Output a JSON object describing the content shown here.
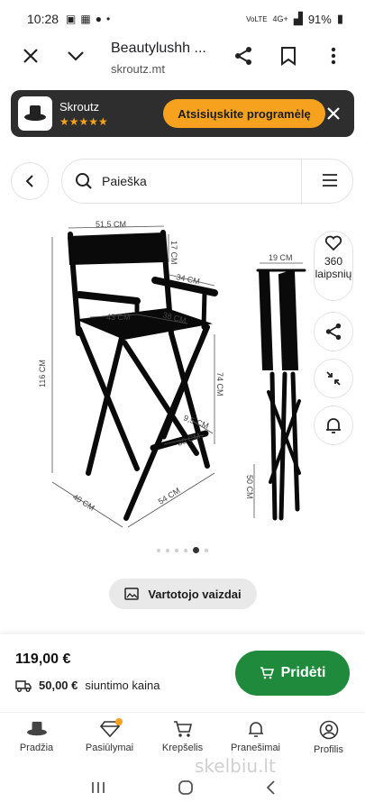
{
  "status": {
    "time": "10:28",
    "battery": "91%",
    "network": "4G+",
    "volte": "VoLTE"
  },
  "browser": {
    "title": "Beautylushh ...",
    "url": "skroutz.mt"
  },
  "banner": {
    "app_name": "Skroutz",
    "rating_stars": "★★★★★",
    "cta_label": "Atsisiųskite programėlę",
    "accent": "#f6a21f"
  },
  "search": {
    "placeholder": "Paieška"
  },
  "product_image": {
    "dimensions": {
      "seat_width": "51,5 CM",
      "back_height": "17 CM",
      "armrest": "34 CM",
      "seat_depth_a": "43 CM",
      "seat_depth_b": "38 CM",
      "total_height": "116 CM",
      "seat_height": "74 CM",
      "footrest": "9,5 CM",
      "footrest_width": "30 CM",
      "base_depth": "40 CM",
      "base_width": "54 CM",
      "folded_width": "19 CM",
      "folded_depth": "50 CM"
    }
  },
  "favorites": {
    "count": "360",
    "label": "laipsnių"
  },
  "gallery": {
    "total": 6,
    "active_index": 4
  },
  "user_images_label": "Vartotojo vaizdai",
  "purchase": {
    "price": "119,00 €",
    "shipping_amount": "50,00 €",
    "shipping_label": "siuntimo kaina",
    "add_label": "Pridėti",
    "accent": "#1f8a3c"
  },
  "tabs": [
    {
      "label": "Pradžia",
      "icon": "home-hat-icon"
    },
    {
      "label": "Pasiūlymai",
      "icon": "diamond-icon"
    },
    {
      "label": "Krepšelis",
      "icon": "cart-icon"
    },
    {
      "label": "Pranešimai",
      "icon": "bell-icon"
    },
    {
      "label": "Profilis",
      "icon": "profile-icon"
    }
  ],
  "watermark": "skelbiu.lt"
}
